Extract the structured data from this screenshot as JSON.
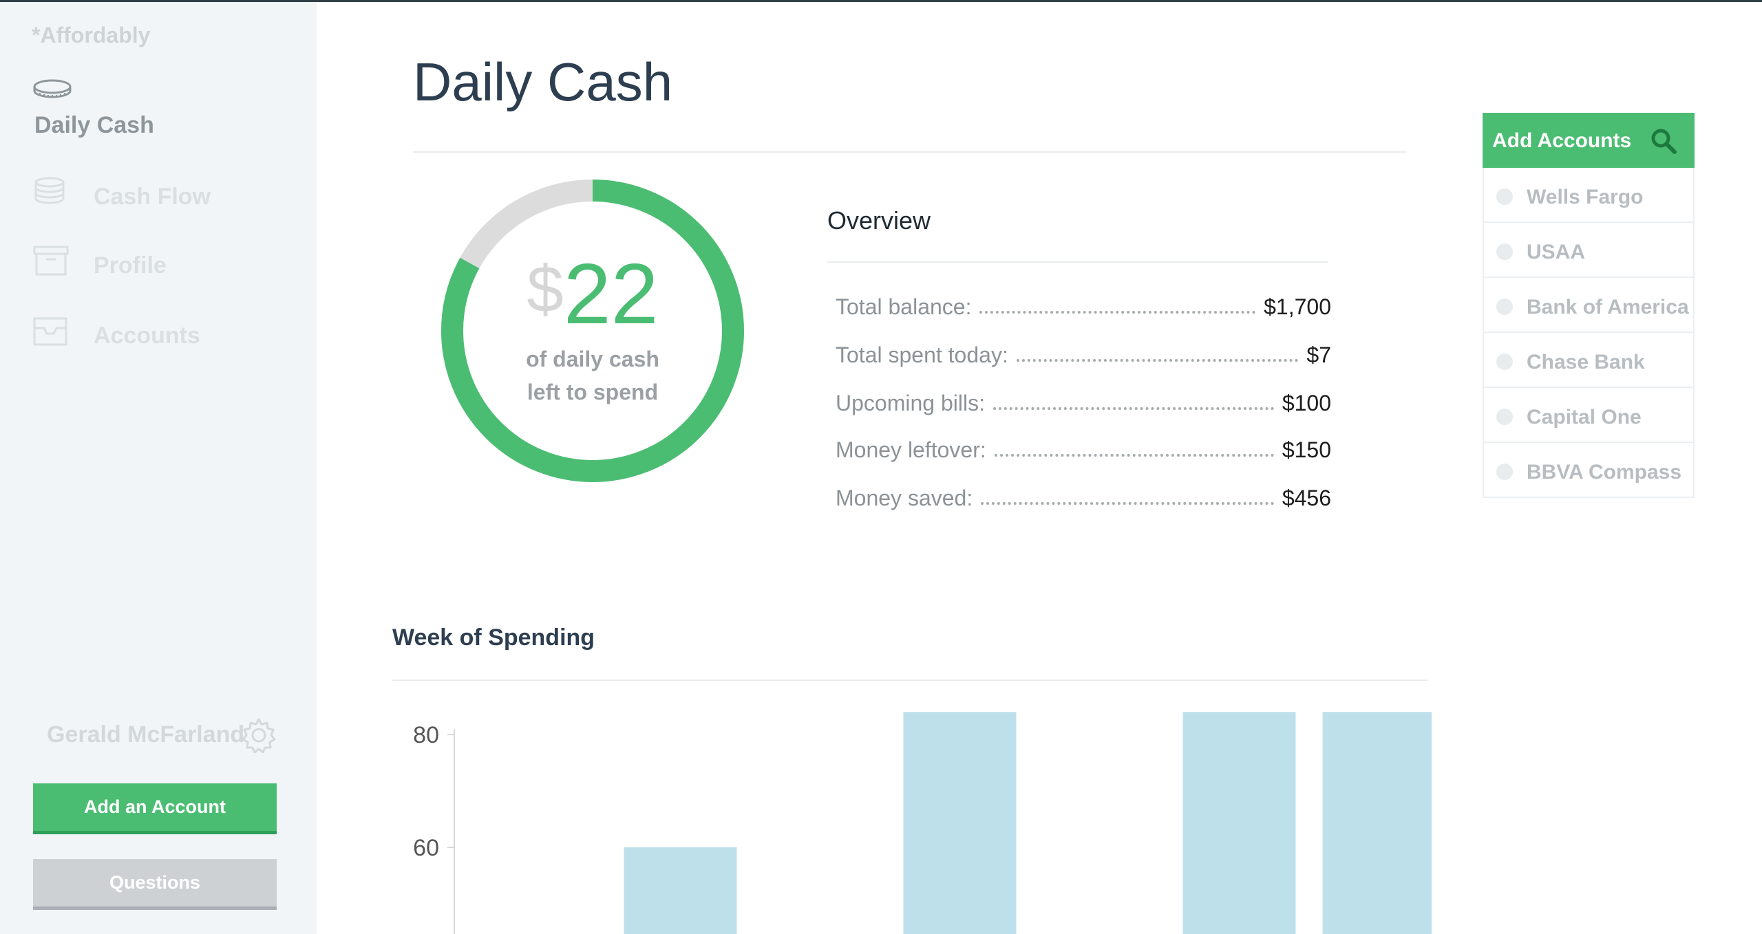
{
  "brand": "*Affordably",
  "nav": [
    {
      "label": "Daily Cash",
      "icon": "coin-icon",
      "active": true
    },
    {
      "label": "Cash Flow",
      "icon": "coin-stack-icon",
      "active": false
    },
    {
      "label": "Profile",
      "icon": "box-icon",
      "active": false
    },
    {
      "label": "Accounts",
      "icon": "inbox-tray-icon",
      "active": false
    }
  ],
  "user": {
    "name": "Gerald McFarland",
    "icon": "gear-icon"
  },
  "buttons": {
    "add_account": "Add an Account",
    "questions": "Questions"
  },
  "page_title": "Daily Cash",
  "gauge": {
    "currency": "$",
    "value": "22",
    "caption_line1": "of daily cash",
    "caption_line2": "left to spend",
    "fraction": 0.83,
    "fill_color": "#4bbd72",
    "track_color": "#dcdcdc"
  },
  "overview": {
    "title": "Overview",
    "rows": [
      {
        "label": "Total balance:",
        "value": "$1,700"
      },
      {
        "label": "Total spent today:",
        "value": "$7"
      },
      {
        "label": "Upcoming bills:",
        "value": "$100"
      },
      {
        "label": "Money leftover:",
        "value": "$150"
      },
      {
        "label": "Money saved:",
        "value": "$456"
      }
    ]
  },
  "accounts_panel": {
    "title": "Add Accounts",
    "search_icon": "search-icon",
    "items": [
      "Wells Fargo",
      "USAA",
      "Bank of America",
      "Chase Bank",
      "Capital One",
      "BBVA Compass"
    ]
  },
  "week_title": "Week of Spending",
  "chart_data": {
    "type": "bar",
    "title": "Week of Spending",
    "y_ticks": [
      80,
      60
    ],
    "ylim": [
      40,
      84
    ],
    "values": [
      null,
      60,
      null,
      84,
      null,
      84,
      84
    ],
    "bar_color": "#bee0ea",
    "grid": false
  },
  "colors": {
    "accent": "#4bbd72",
    "title": "#2d3e50",
    "sidebar_bg": "#f1f5f8"
  }
}
